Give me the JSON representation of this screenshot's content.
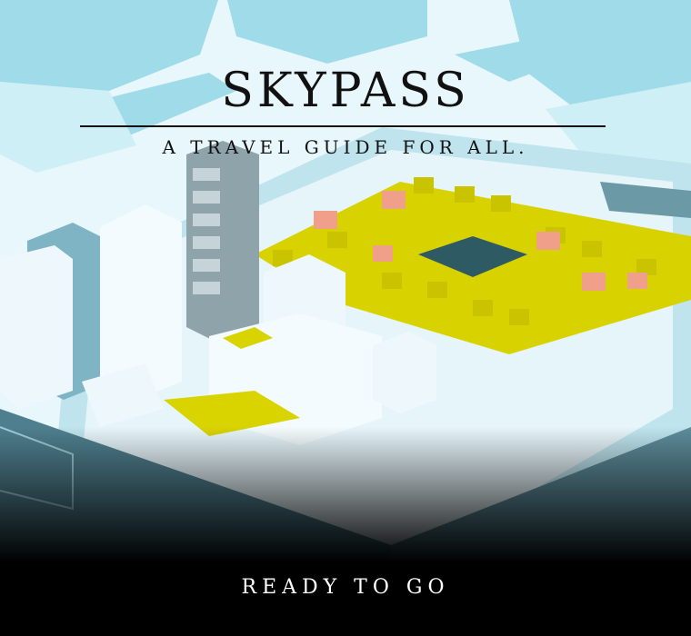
{
  "app": {
    "title": "SKYPASS",
    "subtitle": "A TRAVEL GUIDE FOR ALL.",
    "cta_label": "READY TO GO"
  },
  "colors": {
    "sky": "#bfe8f2",
    "building": "#eaf6fb",
    "shadow": "#7fc7d8",
    "park": "#d9d300",
    "tree": "#c7c100",
    "blossom": "#f0a08a",
    "road": "#4f7f8e",
    "fade": "#000000"
  },
  "image": {
    "description_icon": "isometric-city-illustration"
  }
}
